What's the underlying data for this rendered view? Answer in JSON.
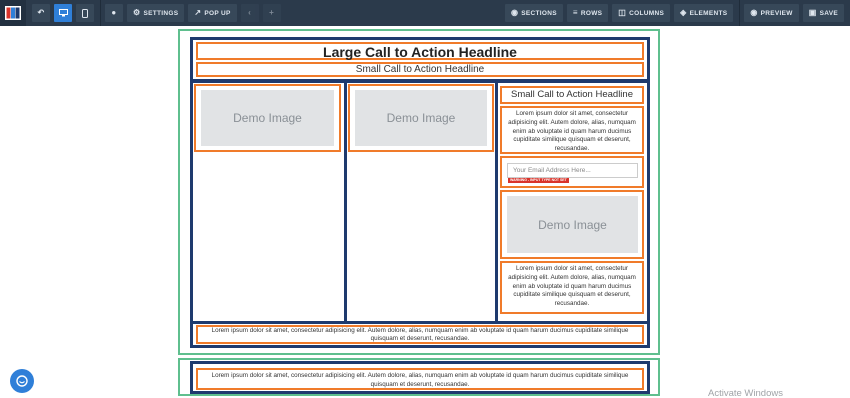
{
  "toolbar": {
    "settings_label": "SETTINGS",
    "popup_label": "POP UP",
    "sections_label": "SECTIONS",
    "rows_label": "ROWS",
    "columns_label": "COLUMNS",
    "elements_label": "ELEMENTS",
    "preview_label": "PREVIEW",
    "save_label": "SAVE",
    "active_view": "desktop"
  },
  "section1": {
    "headline_large": "Large Call to Action Headline",
    "headline_small": "Small Call to Action Headline",
    "col1": {
      "image_label": "Demo Image"
    },
    "col2": {
      "image_label": "Demo Image"
    },
    "col3": {
      "headline": "Small Call to Action Headline",
      "paragraph": "Lorem ipsum dolor sit amet, consectetur adipisicing elit. Autem dolore, alias, numquam enim ab voluptate id quam harum ducimus cupiditate similique quisquam et deserunt, recusandae.",
      "email_placeholder": "Your Email Address Here...",
      "email_warning": "WARNING - INPUT TYPE NOT SET",
      "image_label": "Demo Image",
      "paragraph2": "Lorem ipsum dolor sit amet, consectetur adipisicing elit. Autem dolore, alias, numquam enim ab voluptate id quam harum ducimus cupiditate similique quisquam et deserunt, recusandae."
    },
    "footer_text": "Lorem ipsum dolor sit amet, consectetur adipisicing elit. Autem dolore, alias, numquam enim ab voluptate id quam harum ducimus cupiditate similique quisquam et deserunt, recusandae."
  },
  "section2": {
    "text": "Lorem ipsum dolor sit amet, consectetur adipisicing elit. Autem dolore, alias, numquam enim ab voluptate id quam harum ducimus cupiditate similique quisquam et deserunt, recusandae."
  },
  "watermark": "Activate Windows",
  "colors": {
    "toolbar": "#2b3a4b",
    "accent": "#2f7fd8",
    "section_outline": "#5fbf8e",
    "row_outline": "#1e3a6e",
    "element_outline": "#f07b2a"
  }
}
